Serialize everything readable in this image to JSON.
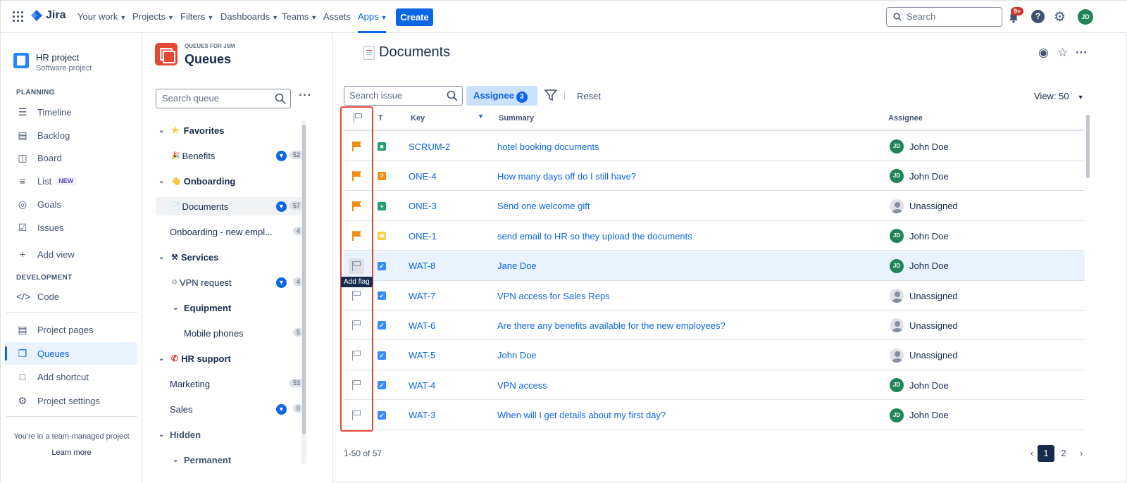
{
  "nav": {
    "logo": "Jira",
    "items": [
      "Your work",
      "Projects",
      "Filters",
      "Dashboards",
      "Teams",
      "Assets",
      "Apps"
    ],
    "create": "Create",
    "search_placeholder": "Search",
    "notif_badge": "9+",
    "avatar": "JD"
  },
  "sidebar": {
    "project_name": "HR project",
    "project_sub": "Software project",
    "planning": "PLANNING",
    "planning_items": [
      {
        "label": "Timeline",
        "icon": "timeline-icon"
      },
      {
        "label": "Backlog",
        "icon": "backlog-icon"
      },
      {
        "label": "Board",
        "icon": "board-icon"
      },
      {
        "label": "List",
        "icon": "list-icon",
        "tag": "NEW"
      },
      {
        "label": "Goals",
        "icon": "goals-icon"
      },
      {
        "label": "Issues",
        "icon": "issues-icon"
      }
    ],
    "add_view": "Add view",
    "development": "DEVELOPMENT",
    "code": "Code",
    "project_pages": "Project pages",
    "queues": "Queues",
    "add_shortcut": "Add shortcut",
    "project_settings": "Project settings",
    "team_note": "You're in a team-managed project",
    "learn_more": "Learn more"
  },
  "queues": {
    "supertitle": "QUEUES FOR JSM",
    "title": "Queues",
    "search_placeholder": "Search queue",
    "favorites": "Favorites",
    "benefits": {
      "label": "Benefits",
      "count": "52"
    },
    "onboarding": "Onboarding",
    "documents": {
      "label": "Documents",
      "count": "57"
    },
    "onboarding_new": {
      "label": "Onboarding - new empl...",
      "count": "4"
    },
    "services": "Services",
    "vpn": {
      "label": "VPN request",
      "count": "4"
    },
    "equipment": "Equipment",
    "mobile": {
      "label": "Mobile phones",
      "count": "5"
    },
    "hr_support": "HR support",
    "marketing": {
      "label": "Marketing",
      "count": "53"
    },
    "sales": {
      "label": "Sales",
      "count": "0"
    },
    "hidden": "Hidden",
    "permanent": "Permanent"
  },
  "main": {
    "title": "Documents",
    "search_placeholder": "Search issue",
    "assignee_label": "Assignee",
    "assignee_count": "3",
    "reset": "Reset",
    "view": "View: 50",
    "columns": {
      "type": "T",
      "key": "Key",
      "summary": "Summary",
      "assignee": "Assignee"
    },
    "tooltip": "Add flag",
    "pagination_text": "1-50 of 57",
    "pages": [
      "1",
      "2"
    ],
    "rows": [
      {
        "flagged": true,
        "type": "story",
        "type_color": "#22a06b",
        "key": "SCRUM-2",
        "summary": "hotel booking documents",
        "assignee": "John Doe",
        "assigned": true
      },
      {
        "flagged": true,
        "type": "question",
        "type_color": "#f18d13",
        "key": "ONE-4",
        "summary": "How many days off do I still have?",
        "assignee": "John Doe",
        "assigned": true
      },
      {
        "flagged": true,
        "type": "new-feature",
        "type_color": "#22a06b",
        "key": "ONE-3",
        "summary": "Send one welcome gift",
        "assignee": "Unassigned",
        "assigned": false
      },
      {
        "flagged": true,
        "type": "email",
        "type_color": "#f5cd47",
        "key": "ONE-1",
        "summary": "send email to HR so they upload the documents",
        "assignee": "John Doe",
        "assigned": true
      },
      {
        "flagged": false,
        "type": "task",
        "type_color": "#388bff",
        "key": "WAT-8",
        "summary": "Jane Doe",
        "assignee": "John Doe",
        "assigned": true
      },
      {
        "flagged": false,
        "type": "task",
        "type_color": "#388bff",
        "key": "WAT-7",
        "summary": "VPN access for Sales Reps",
        "assignee": "Unassigned",
        "assigned": false
      },
      {
        "flagged": false,
        "type": "task",
        "type_color": "#388bff",
        "key": "WAT-6",
        "summary": "Are there any benefits available for the new employees?",
        "assignee": "Unassigned",
        "assigned": false
      },
      {
        "flagged": false,
        "type": "task",
        "type_color": "#388bff",
        "key": "WAT-5",
        "summary": "John Doe",
        "assignee": "Unassigned",
        "assigned": false
      },
      {
        "flagged": false,
        "type": "task",
        "type_color": "#388bff",
        "key": "WAT-4",
        "summary": "VPN access",
        "assignee": "John Doe",
        "assigned": true
      },
      {
        "flagged": false,
        "type": "task",
        "type_color": "#388bff",
        "key": "WAT-3",
        "summary": "When will I get details about my first day?",
        "assignee": "John Doe",
        "assigned": true
      }
    ]
  }
}
